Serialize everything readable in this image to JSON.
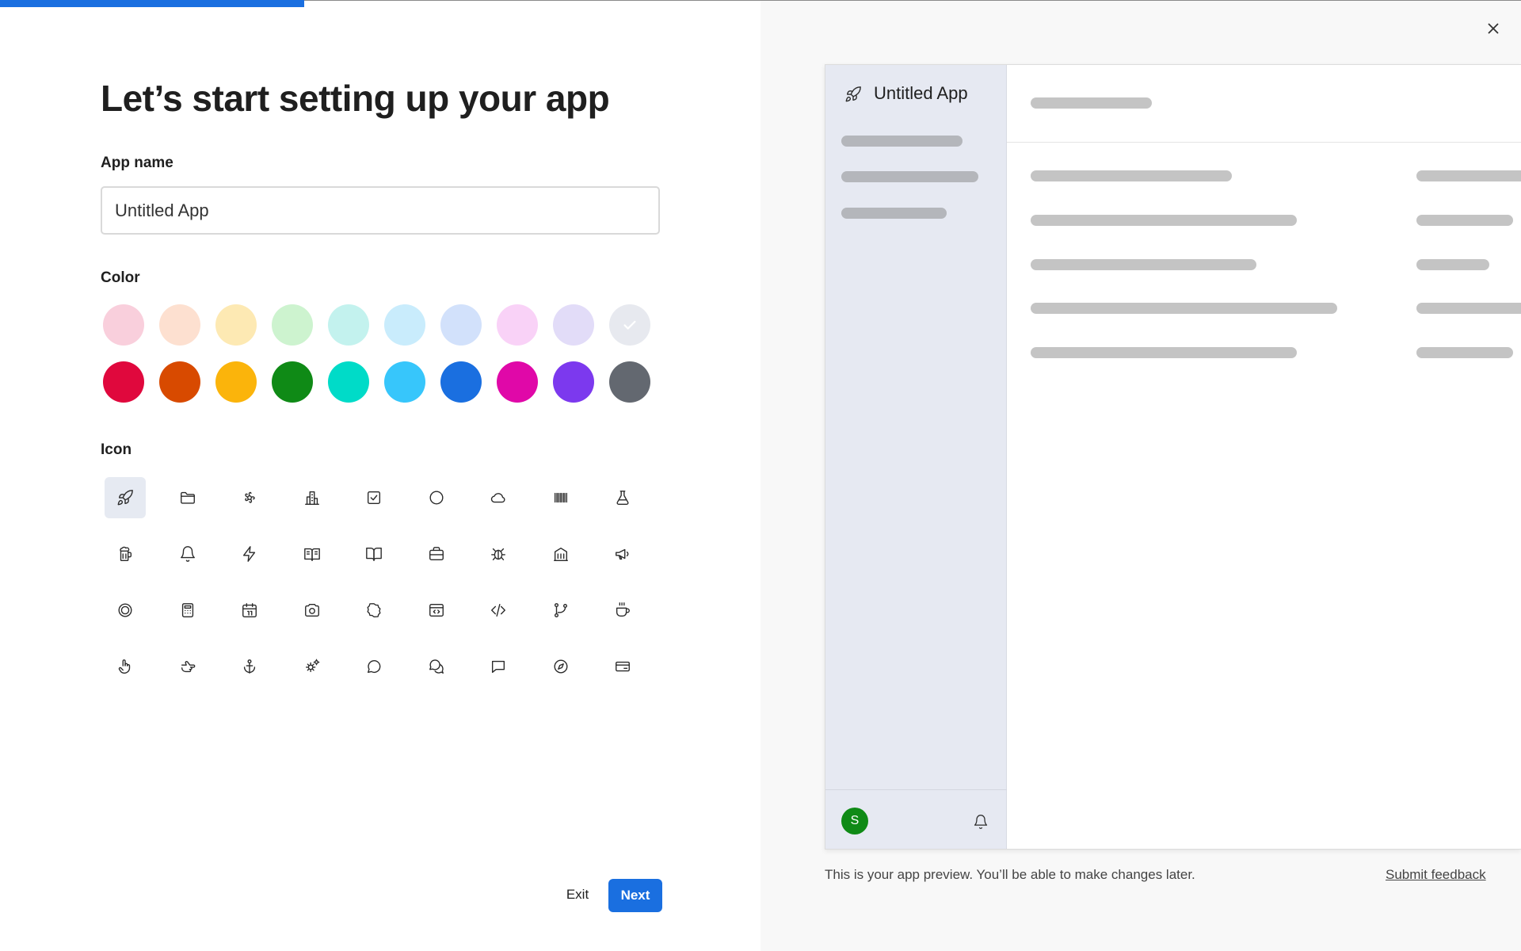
{
  "progress": {
    "value": 0.2
  },
  "title": "Let’s start setting up your app",
  "app_name": {
    "label": "App name",
    "value": "Untitled App"
  },
  "color": {
    "label": "Color",
    "selected": "gray-light",
    "swatches": [
      {
        "name": "pink-light",
        "hex": "#f9cfdc"
      },
      {
        "name": "peach-light",
        "hex": "#fde0d0"
      },
      {
        "name": "yellow-light",
        "hex": "#fde9b3"
      },
      {
        "name": "green-light",
        "hex": "#cdf3cf"
      },
      {
        "name": "teal-light",
        "hex": "#c3f2ee"
      },
      {
        "name": "sky-light",
        "hex": "#c9ecfc"
      },
      {
        "name": "blue-light",
        "hex": "#d2e1fb"
      },
      {
        "name": "magenta-light",
        "hex": "#f9d2f7"
      },
      {
        "name": "purple-light",
        "hex": "#e2dcf8"
      },
      {
        "name": "gray-light",
        "hex": "#e7e9ef"
      },
      {
        "name": "red",
        "hex": "#e0083d"
      },
      {
        "name": "orange",
        "hex": "#d84a00"
      },
      {
        "name": "yellow",
        "hex": "#fbb40b"
      },
      {
        "name": "green",
        "hex": "#0f8a16"
      },
      {
        "name": "teal",
        "hex": "#00dbc8"
      },
      {
        "name": "sky",
        "hex": "#37c6fb"
      },
      {
        "name": "blue",
        "hex": "#1a6fe0"
      },
      {
        "name": "magenta",
        "hex": "#e008a8"
      },
      {
        "name": "purple",
        "hex": "#7c39ee"
      },
      {
        "name": "gray",
        "hex": "#636870"
      }
    ]
  },
  "icon": {
    "label": "Icon",
    "selected": "rocket",
    "items": [
      "rocket",
      "folder",
      "flower",
      "buildings",
      "checkbox",
      "circle",
      "cloud",
      "barcode",
      "flask",
      "beer",
      "bell",
      "lightning",
      "book-open-lines",
      "book",
      "briefcase",
      "bug",
      "library",
      "megaphone",
      "ring",
      "calculator",
      "calendar",
      "camera",
      "badge",
      "browser-code",
      "code",
      "git-branch",
      "coffee",
      "hand-pointer",
      "hand-point-right",
      "anchor",
      "gears",
      "speech-bubble",
      "chat",
      "message-square",
      "compass",
      "credit-card"
    ]
  },
  "buttons": {
    "exit": "Exit",
    "next": "Next"
  },
  "preview": {
    "app_name": "Untitled App",
    "avatar_initial": "S",
    "caption": "This is your app preview. You’ll be able to make changes later.",
    "feedback": "Submit feedback"
  }
}
